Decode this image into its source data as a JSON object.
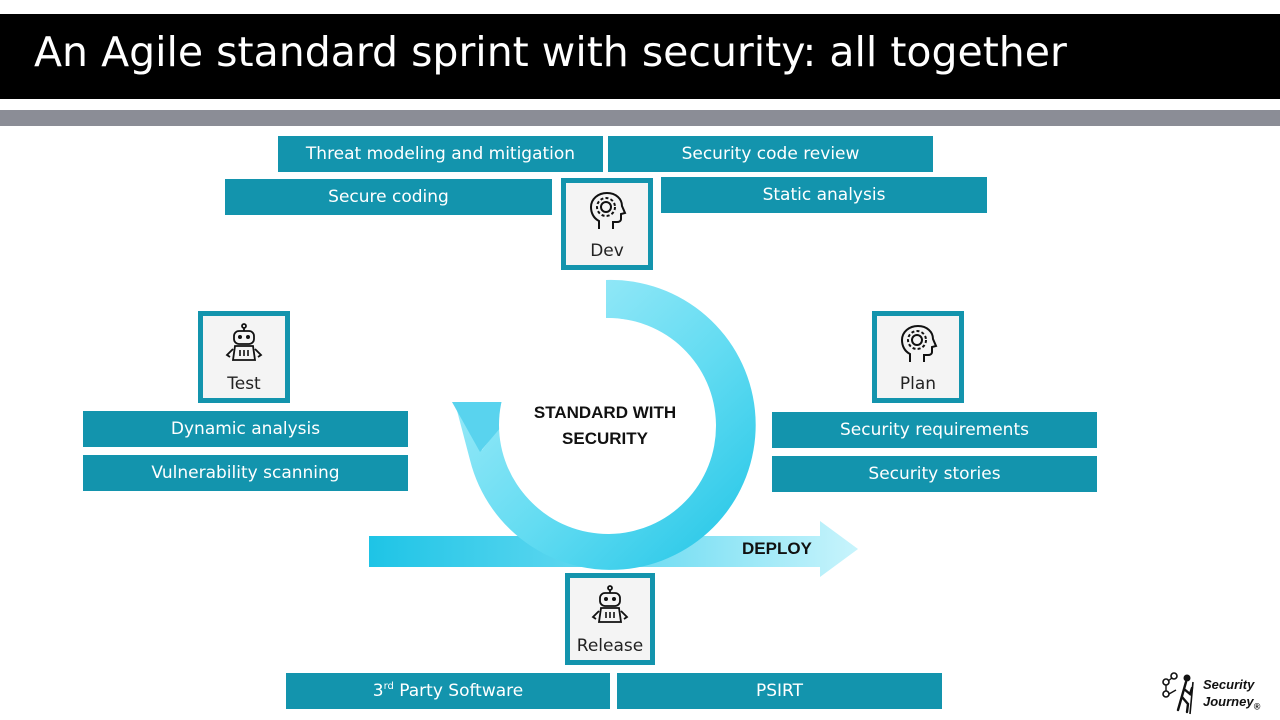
{
  "slide": {
    "title": "An Agile standard sprint with security: all together",
    "center_label_line1": "STANDARD WITH",
    "center_label_line2": "SECURITY",
    "deploy_label": "DEPLOY"
  },
  "stages": {
    "dev": "Dev",
    "plan": "Plan",
    "test": "Test",
    "release": "Release"
  },
  "activities": {
    "threat_modeling": "Threat modeling and mitigation",
    "security_code_review": "Security code review",
    "secure_coding": "Secure coding",
    "static_analysis": "Static analysis",
    "dynamic_analysis": "Dynamic analysis",
    "vulnerability_scanning": "Vulnerability scanning",
    "security_requirements": "Security requirements",
    "security_stories": "Security stories",
    "third_party_prefix": "3",
    "third_party_sup": "rd",
    "third_party_rest": " Party Software",
    "psirt": "PSIRT"
  },
  "logo": {
    "line1": "Security",
    "line2": "Journey",
    "mark": "®"
  },
  "colors": {
    "tag_bg": "#1394ad",
    "cycle_light": "#a8ecf8",
    "cycle_dark": "#1ec4e6",
    "title_bg": "#000000",
    "divider": "#8b8d96"
  },
  "icons": {
    "dev": "head-gear-icon",
    "plan": "head-gear-icon",
    "test": "robot-icon",
    "release": "robot-icon"
  }
}
